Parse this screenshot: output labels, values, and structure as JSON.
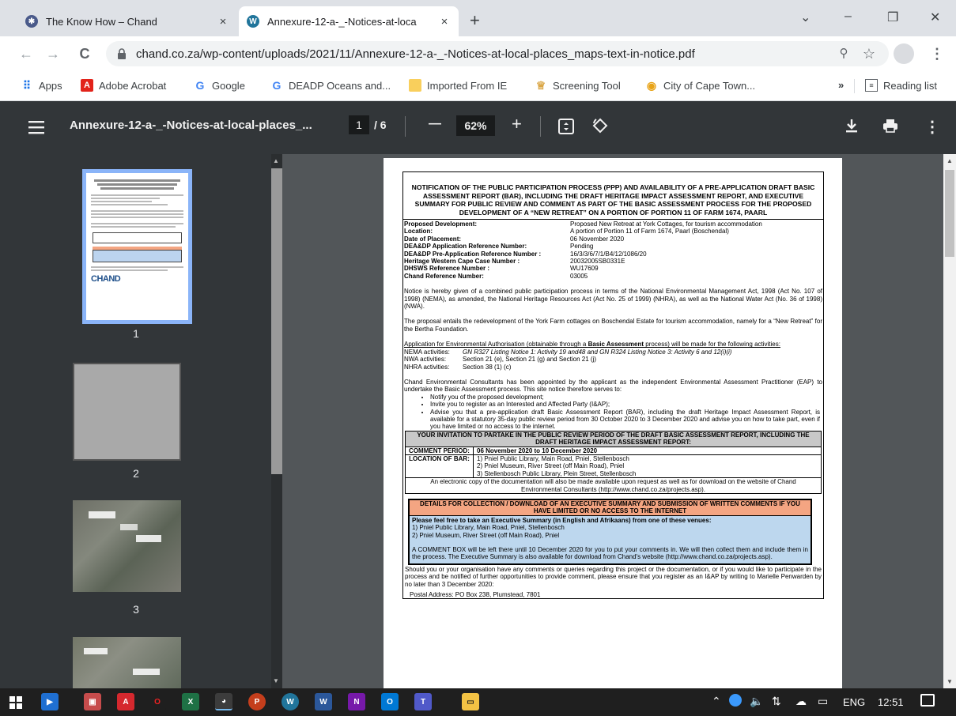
{
  "tabs": [
    {
      "title": "The Know How – Chand",
      "close": "×"
    },
    {
      "title": "Annexure-12-a-_-Notices-at-loca",
      "close": "×"
    }
  ],
  "new_tab": "+",
  "window": {
    "dropdown": "⌄",
    "minimize": "–",
    "restore": "❐",
    "close": "✕"
  },
  "nav": {
    "back": "←",
    "forward": "→",
    "reload": "C",
    "url": "chand.co.za/wp-content/uploads/2021/11/Annexure-12-a-_-Notices-at-local-places_maps-text-in-notice.pdf"
  },
  "bookmarks": {
    "items": [
      "Apps",
      "Adobe Acrobat",
      "Google",
      "DEADP Oceans and...",
      "Imported From IE",
      "Screening Tool",
      "City of Cape Town..."
    ],
    "more": "»",
    "reading_list": "Reading list"
  },
  "pdf": {
    "title": "Annexure-12-a-_-Notices-at-local-places_...",
    "page": "1",
    "total": "/  6",
    "zoom_out": "—",
    "zoom": "62%",
    "zoom_in": "+"
  },
  "thumbnails": [
    "1",
    "2",
    "3"
  ],
  "thumb_logo": "CHAND",
  "document": {
    "heading": "NOTIFICATION OF THE PUBLIC PARTICIPATION PROCESS (PPP) AND AVAILABILITY OF A PRE-APPLICATION DRAFT BASIC ASSESSMENT REPORT (BAR), INCLUDING THE DRAFT HERITAGE IMPACT ASSESSMENT REPORT, AND EXECUTIVE SUMMARY FOR PUBLIC REVIEW AND COMMENT AS PART OF THE BASIC ASSESSMENT PROCESS FOR THE PROPOSED DEVELOPMENT OF A “NEW RETREAT” ON A PORTION OF PORTION 11 OF FARM 1674, PAARL",
    "fields": [
      {
        "k": "Proposed Development:",
        "v": "Proposed New Retreat at York Cottages, for tourism accommodation"
      },
      {
        "k": "Location:",
        "v": "A portion of Portion 11 of Farm 1674, Paarl (Boschendal)"
      },
      {
        "k": "Date of Placement:",
        "v": "06 November 2020"
      },
      {
        "k": "DEA&DP Application Reference Number:",
        "v": "Pending"
      },
      {
        "k": "DEA&DP Pre-Application Reference Number :",
        "v": "16/3/3/6/7/1/B4/12/1086/20"
      },
      {
        "k": "Heritage Western Cape Case Number :",
        "v": "20032005SB0331E"
      },
      {
        "k": "DHSWS Reference Number :",
        "v": "WU17609"
      },
      {
        "k": "Chand Reference Number:",
        "v": "03005"
      }
    ],
    "p1": "Notice is hereby given of a combined public participation process in terms of the National Environmental Management Act, 1998 (Act No. 107 of 1998) (NEMA), as amended, the National Heritage Resources Act (Act No. 25 of 1999) (NHRA), as well as the National Water Act (No. 36 of 1998) (NWA).",
    "p2": "The proposal entails the redevelopment of the York Farm cottages on Boschendal Estate for tourism accommodation, namely for a “New Retreat” for the Bertha Foundation.",
    "p3a": "Application for Environmental Authorisation (obtainable through a ",
    "p3b": "Basic Assessment",
    "p3c": " process) will be made for the following activities:",
    "acts": [
      {
        "k": "NEMA activities:",
        "v": "GN R327 Listing Notice 1: Activity 19 and48 and GN R324 Listing Notice 3: Activity 6 and 12(i)(i)"
      },
      {
        "k": "NWA activities:",
        "v": "Section 21 (e), Section 21 (g) and Section 21 (j)"
      },
      {
        "k": "NHRA activities:",
        "v": "Section 38 (1) (c)"
      }
    ],
    "p4": "Chand Environmental Consultants has been appointed by the applicant as the independent Environmental Assessment Practitioner (EAP) to undertake the Basic Assessment process. This site notice therefore serves to:",
    "bullets": [
      "Notify you of the proposed development;",
      "Invite you to register as an Interested and Affected Party (I&AP);",
      "Advise you that a pre-application draft Basic Assessment Report (BAR), including the draft Heritage Impact Assessment Report, is available for a statutory 35-day public review period from 30 October 2020 to 3 December 2020 and advise you on how to take part, even if you have limited or no access to the internet."
    ],
    "invite": "YOUR INVITATION TO PARTAKE IN THE PUBLIC REVIEW PERIOD OF THE DRAFT BASIC ASSESSMENT REPORT, INCLUDING THE DRAFT HERITAGE IMPACT ASSESSMENT REPORT:",
    "comment_label": "COMMENT PERIOD:",
    "comment_value": "06 November 2020 to 10 December 2020",
    "location_label": "LOCATION OF BAR:",
    "locations": [
      "1)  Pniel Public Library, Main Road, Pniel, Stellenbosch",
      "2)  Pniel Museum, River Street (off Main Road), Pniel",
      "3)  Stellenbosch Public Library, Plein Street, Stellenbosch"
    ],
    "electronic": "An electronic copy of the documentation will also be made available upon request as well as for download on the website of Chand Environmental Consultants (http://www.chand.co.za/projects.asp).",
    "details_head": "DETAILS FOR COLLECTION / DOWNLOAD OF AN EXECUTIVE SUMMARY AND SUBMISSION OF WRITTEN COMMENTS IF YOU HAVE LIMITED OR NO ACCESS TO THE INTERNET",
    "details_intro": "Please feel free to take an Executive Summary (in English and Afrikaans) from one of these venues:",
    "details_venues": [
      "1)  Pniel Public Library, Main Road, Pniel, Stellenbosch",
      "2)  Pniel Museum, River Street (off Main Road), Pniel"
    ],
    "comment_box": "A COMMENT BOX will be left there until 10 December 2020 for you to put your comments in. We will then collect them and include them in the process. The Executive Summary is also available for download from Chand's website (http://www.chand.co.za/projects.asp).",
    "closing": "Should you or your organisation have any comments or queries regarding this project or the documentation, or if you would like to participate in the process and be notified of further opportunities to provide comment, please ensure that you register as an I&AP by writing to Marielle Penwarden by no later than 3 December 2020:",
    "postal": "Postal Address:          PO Box 238, Plumstead, 7801"
  },
  "taskbar": {
    "lang": "ENG",
    "time": "12:51"
  }
}
